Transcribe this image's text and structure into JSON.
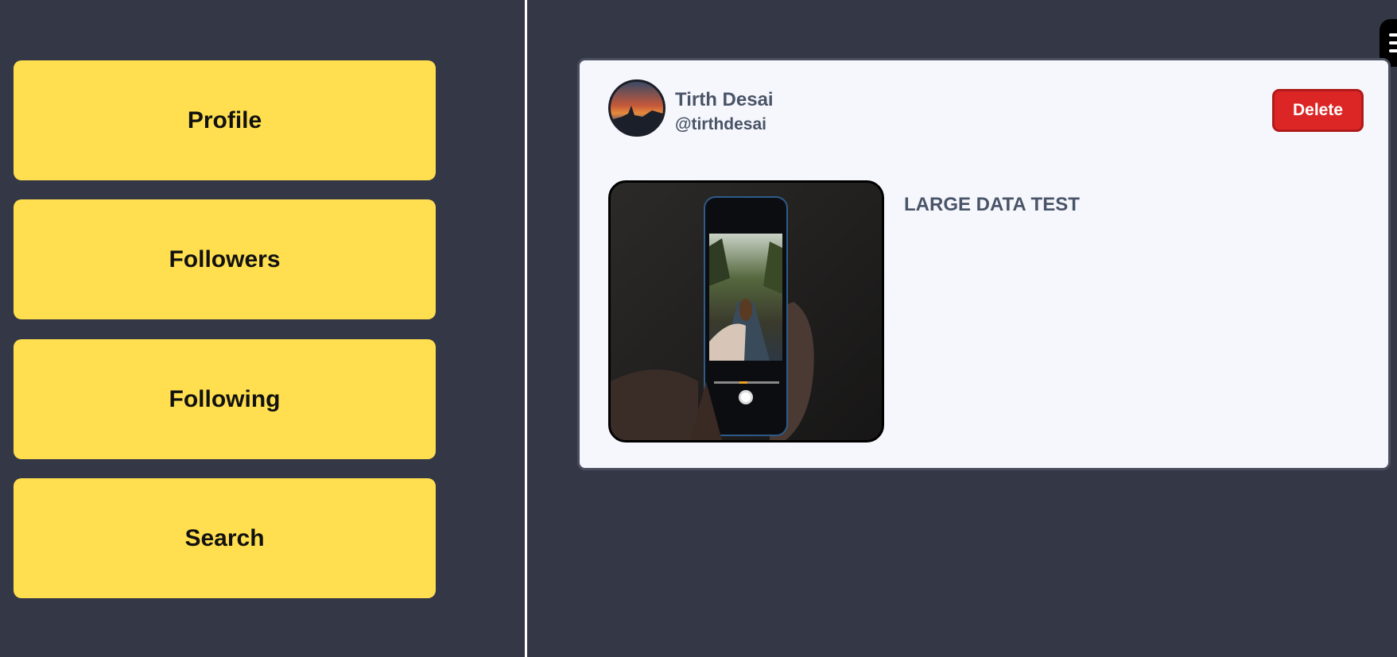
{
  "sidebar": {
    "items": [
      {
        "label": "Profile"
      },
      {
        "label": "Followers"
      },
      {
        "label": "Following"
      },
      {
        "label": "Search"
      }
    ]
  },
  "menu": {
    "icon": "hamburger-menu-icon"
  },
  "post": {
    "author_name": "Tirth Desai",
    "author_handle": "@tirthdesai",
    "delete_label": "Delete",
    "text": "LARGE DATA TEST"
  },
  "colors": {
    "background": "#343745",
    "nav_button": "#ffdf4f",
    "card": "#f6f7fc",
    "delete": "#dc2626",
    "text_muted": "#4a5468"
  }
}
